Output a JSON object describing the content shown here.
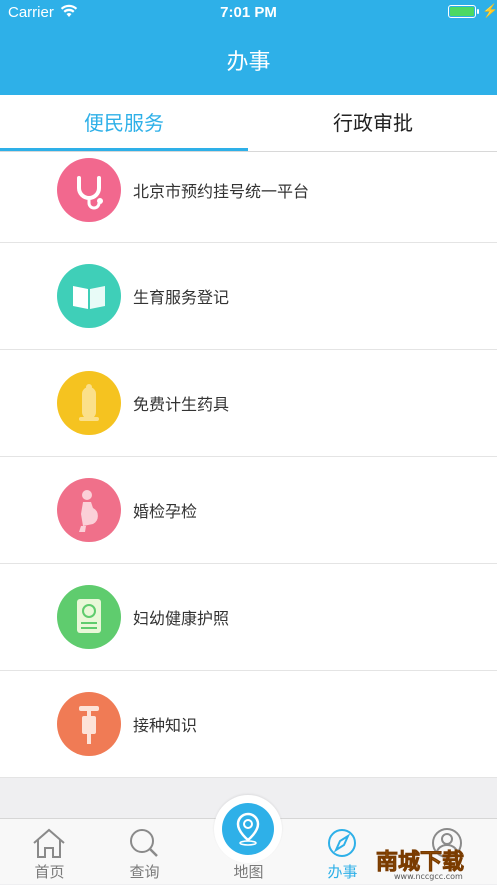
{
  "status_bar": {
    "carrier": "Carrier",
    "time": "7:01 PM"
  },
  "nav": {
    "title": "办事"
  },
  "tabs": [
    {
      "label": "便民服务",
      "active": true
    },
    {
      "label": "行政审批",
      "active": false
    }
  ],
  "services": [
    {
      "label": "北京市预约挂号统一平台",
      "icon": "stethoscope-icon",
      "color": "#f2688e"
    },
    {
      "label": "生育服务登记",
      "icon": "book-icon",
      "color": "#3fcfb8"
    },
    {
      "label": "免费计生药具",
      "icon": "condom-icon",
      "color": "#f5c320"
    },
    {
      "label": "婚检孕检",
      "icon": "pregnant-icon",
      "color": "#f0708a"
    },
    {
      "label": "妇幼健康护照",
      "icon": "passport-icon",
      "color": "#5fcc6e"
    },
    {
      "label": "接种知识",
      "icon": "syringe-icon",
      "color": "#f07b55"
    }
  ],
  "tabbar": {
    "items": [
      {
        "label": "首页",
        "icon": "home-icon"
      },
      {
        "label": "查询",
        "icon": "search-icon"
      },
      {
        "label": "地图",
        "icon": "map-pin-icon"
      },
      {
        "label": "办事",
        "icon": "compass-icon",
        "active": true
      },
      {
        "label": "我的",
        "icon": "user-icon"
      }
    ]
  },
  "watermark": {
    "text": "南城下载",
    "url": "www.nccgcc.com"
  },
  "colors": {
    "primary": "#2eb0e8"
  }
}
